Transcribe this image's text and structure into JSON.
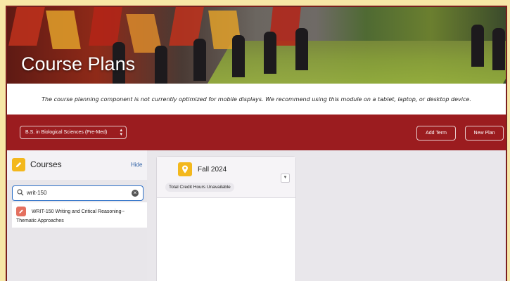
{
  "banner": {
    "title": "Course Plans"
  },
  "notice": {
    "text": "The course planning component is not currently optimized for mobile displays. We recommend using this module on a tablet, laptop, or desktop device."
  },
  "toolbar": {
    "program_select": "B.S. in Biological Sciences (Pre-Med)",
    "add_term_label": "Add Term",
    "new_plan_label": "New Plan"
  },
  "sidebar": {
    "title": "Courses",
    "hide_label": "Hide",
    "search_value": "writ-150",
    "results": [
      {
        "label": "WRIT-150 Writing and Critical Reasoning--Thematic Approaches"
      }
    ]
  },
  "term": {
    "title": "Fall 2024",
    "credit_badge": "Total Credit Hours Unavailable"
  },
  "colors": {
    "brand": "#9b1c1f",
    "accent_gold": "#f3b81d",
    "link": "#2b5fa4",
    "page_border": "#f7e7a6"
  }
}
